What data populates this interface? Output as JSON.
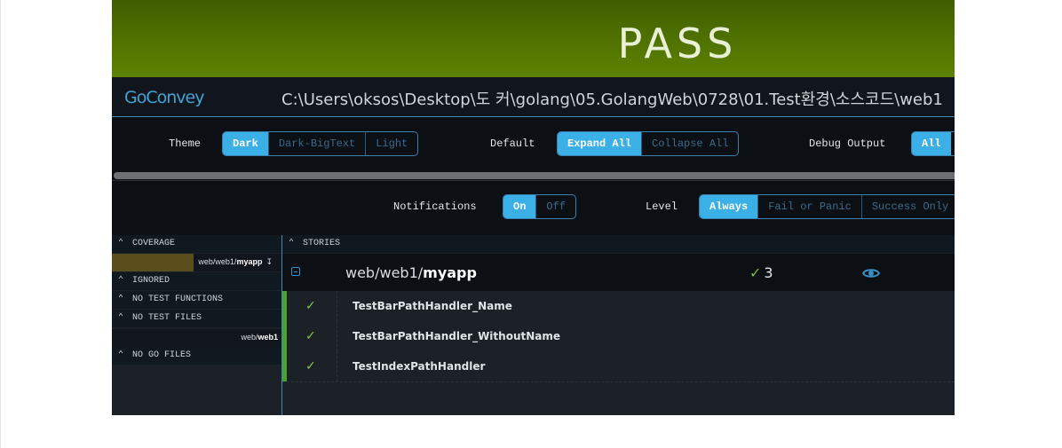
{
  "banner": {
    "status": "PASS"
  },
  "header": {
    "logo": "GoConvey",
    "path": "C:\\Users\\oksos\\Desktop\\도 커\\golang\\05.GolangWeb\\0728\\01.Test환경\\소스코드\\web1"
  },
  "settings": {
    "theme": {
      "label": "Theme",
      "options": [
        "Dark",
        "Dark-BigText",
        "Light"
      ],
      "selected": "Dark"
    },
    "default": {
      "label": "Default",
      "options": [
        "Expand All",
        "Collapse All"
      ],
      "selected": "Expand All"
    },
    "debug": {
      "label": "Debug Output",
      "options": [
        "All"
      ],
      "selected": "All"
    },
    "notifications": {
      "label": "Notifications",
      "options": [
        "On",
        "Off"
      ],
      "selected": "On"
    },
    "level": {
      "label": "Level",
      "options": [
        "Always",
        "Fail or Panic",
        "Success Only"
      ],
      "selected": "Always"
    }
  },
  "sidebar": {
    "coverage": {
      "title": "COVERAGE",
      "item_prefix": "web/web1/",
      "item_name": "myapp",
      "arrow": "↧",
      "coverage_fraction": 0.48
    },
    "ignored": {
      "title": "IGNORED"
    },
    "no_test_functions": {
      "title": "NO TEST FUNCTIONS"
    },
    "no_test_files": {
      "title": "NO TEST FILES",
      "item_prefix": "web/",
      "item_name": "web1"
    },
    "no_go_files": {
      "title": "NO GO FILES"
    }
  },
  "stories": {
    "title": "STORIES",
    "package": {
      "prefix": "web/web1/",
      "name": "myapp",
      "check": "✓",
      "count": "3"
    },
    "tests": [
      {
        "check": "✓",
        "name": "TestBarPathHandler_Name"
      },
      {
        "check": "✓",
        "name": "TestBarPathHandler_WithoutName"
      },
      {
        "check": "✓",
        "name": "TestIndexPathHandler"
      }
    ]
  },
  "colors": {
    "pass_green": "#5e8300",
    "accent_blue": "#3ab0e6",
    "coverage_bar": "#5c4e1c",
    "pass_check": "#7bbf3a"
  }
}
